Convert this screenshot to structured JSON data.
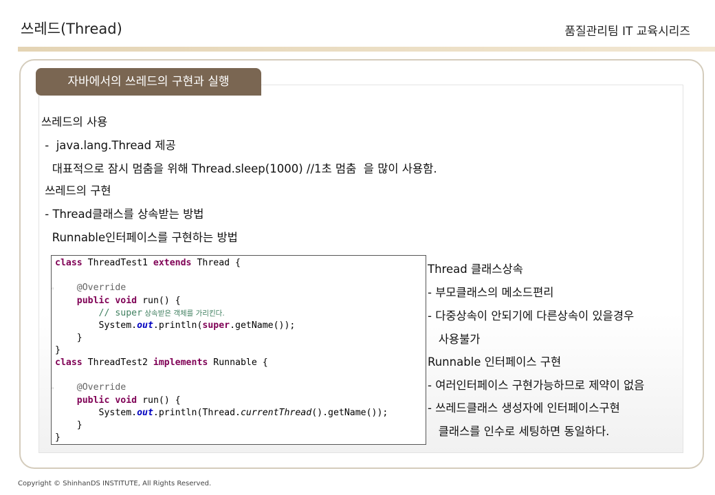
{
  "header": {
    "title": "쓰레드(Thread)",
    "series": "품질관리팀 IT 교육시리즈"
  },
  "section": {
    "badge": "자바에서의 쓰레드의 구현과 실행"
  },
  "body_lines": [
    "쓰레드의 사용",
    " -  java.lang.Thread 제공",
    "   대표적으로 잠시 멈춤을 위해 Thread.sleep(1000) //1초 멈춤  을 많이 사용함.",
    " 쓰레드의 구현",
    " - Thread클래스를 상속받는 방법",
    "   Runnable인터페이스를 구현하는 방법"
  ],
  "code": {
    "l1_kw1": "class",
    "l1_name": " ThreadTest1 ",
    "l1_kw2": "extends",
    "l1_rest": " Thread {",
    "l3_ann": "    @Override",
    "l4_kw1": "public",
    "l4_kw2": "void",
    "l4_rest": " run() {",
    "l5_cm": "        // super",
    "l5_cm2": " 상속받은 객체를 가리킨다.",
    "l6_pre": "        System.",
    "l6_fld": "out",
    "l6_mid": ".println(",
    "l6_kw": "super",
    "l6_rest": ".getName());",
    "l7": "    }",
    "l8": "}",
    "l9_kw1": "class",
    "l9_name": " ThreadTest2 ",
    "l9_kw2": "implements",
    "l9_rest": " Runnable {",
    "l11_ann": "    @Override",
    "l12_kw1": "public",
    "l12_kw2": "void",
    "l12_rest": " run() {",
    "l13_pre": "        System.",
    "l13_fld": "out",
    "l13_mid": ".println(Thread.",
    "l13_it": "currentThread",
    "l13_rest": "().getName());",
    "l14": "    }",
    "l15": "}",
    "marker": "◦"
  },
  "notes": [
    "Thread 클래스상속",
    "- 부모클래스의 메소드편리",
    "- 다중상속이 안되기에 다른상속이 있을경우",
    "   사용불가",
    "Runnable 인터페이스 구현",
    "- 여러인터페이스 구현가능하므로 제약이 없음",
    "- 쓰레드클래스 생성자에 인터페이스구현",
    "   클래스를 인수로 세팅하면 동일하다."
  ],
  "footer": {
    "copyright": "Copyright © ShinhanDS INSTITUTE, All Rights Reserved."
  }
}
